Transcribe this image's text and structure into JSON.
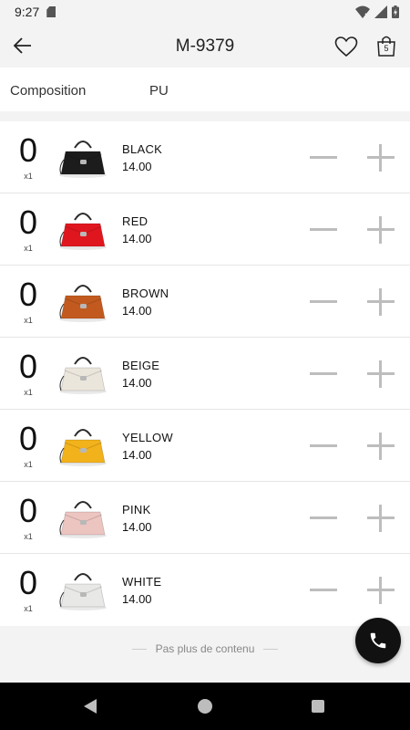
{
  "status_bar": {
    "time": "9:27"
  },
  "header": {
    "title": "M-9379",
    "cart_count": "5"
  },
  "composition": {
    "label": "Composition",
    "value": "PU"
  },
  "products": [
    {
      "quantity": "0",
      "multiplier": "x1",
      "name": "BLACK",
      "price": "14.00",
      "bag_color": "#1c1c1c"
    },
    {
      "quantity": "0",
      "multiplier": "x1",
      "name": "RED",
      "price": "14.00",
      "bag_color": "#e0161e"
    },
    {
      "quantity": "0",
      "multiplier": "x1",
      "name": "BROWN",
      "price": "14.00",
      "bag_color": "#c25a1f"
    },
    {
      "quantity": "0",
      "multiplier": "x1",
      "name": "BEIGE",
      "price": "14.00",
      "bag_color": "#ebe6dc"
    },
    {
      "quantity": "0",
      "multiplier": "x1",
      "name": "YELLOW",
      "price": "14.00",
      "bag_color": "#f2b21b"
    },
    {
      "quantity": "0",
      "multiplier": "x1",
      "name": "PINK",
      "price": "14.00",
      "bag_color": "#ecc4c0"
    },
    {
      "quantity": "0",
      "multiplier": "x1",
      "name": "WHITE",
      "price": "14.00",
      "bag_color": "#e8e8e6"
    }
  ],
  "footer": {
    "end_text": "Pas plus de contenu"
  }
}
